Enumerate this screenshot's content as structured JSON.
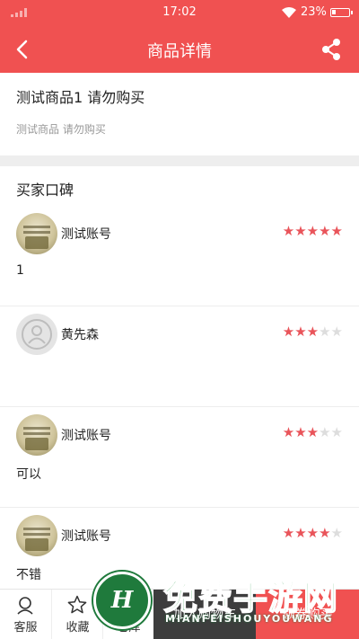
{
  "status_bar": {
    "time": "17:02",
    "battery_percent": "23%",
    "battery_level": 0.23
  },
  "nav": {
    "title": "商品详情"
  },
  "product": {
    "name": "测试商品1 请勿购买",
    "subtitle": "测试商品 请勿购买"
  },
  "reviews": {
    "title": "买家口碑",
    "items": [
      {
        "user": "测试账号",
        "rating": 5,
        "comment": "1",
        "avatar": "photo"
      },
      {
        "user": "黄先森",
        "rating": 3,
        "comment": "",
        "avatar": "default"
      },
      {
        "user": "测试账号",
        "rating": 3,
        "comment": "可以",
        "avatar": "photo"
      },
      {
        "user": "测试账号",
        "rating": 4,
        "comment": "不错",
        "avatar": "photo"
      }
    ]
  },
  "bottom_bar": {
    "service_label": "客服",
    "favorite_label": "收藏",
    "third_label": "仓库",
    "add_to_cart_label": "加入购物车",
    "buy_label": "领券购买"
  },
  "watermark": {
    "text": "免费手游网",
    "subtext": "MIANFEISHOUYOUWANG"
  },
  "colors": {
    "primary": "#f05151",
    "star_on": "#e9545a",
    "star_off": "#dddddd",
    "cart_button": "#3d3d3d"
  }
}
